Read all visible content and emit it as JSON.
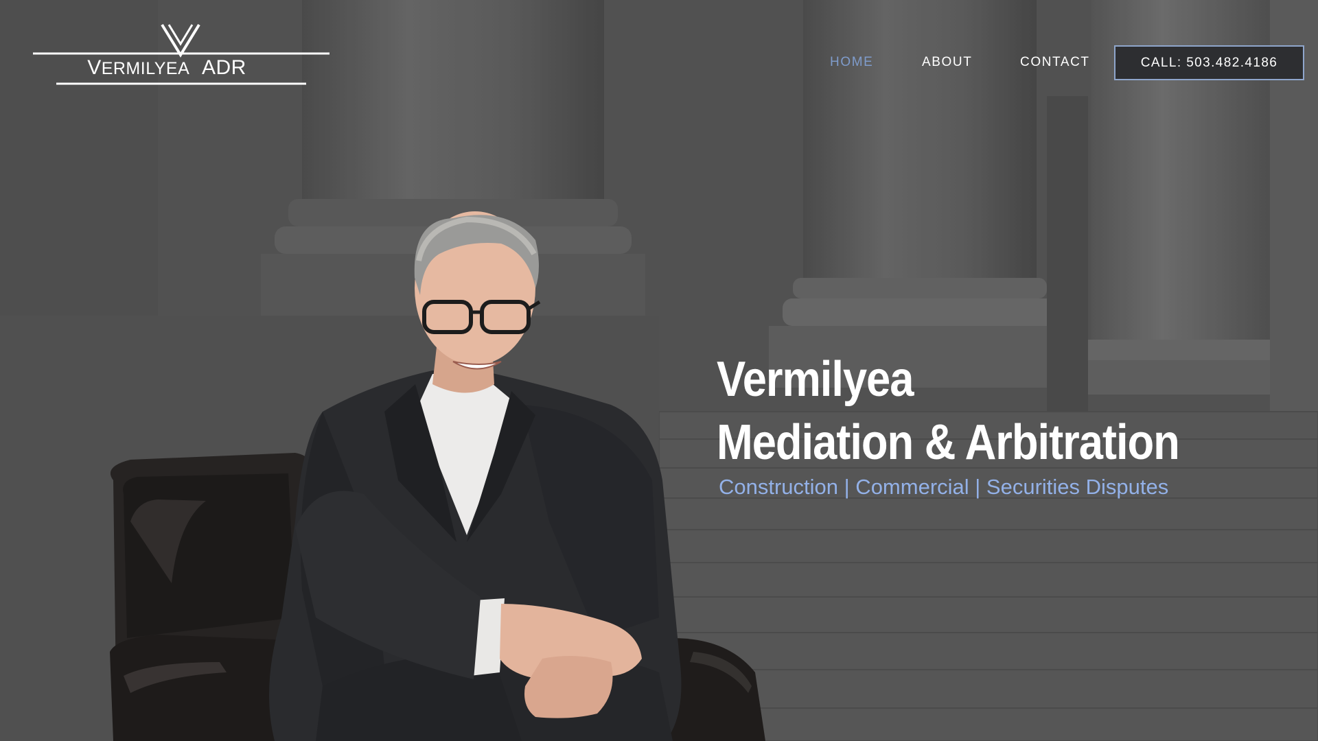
{
  "brand": {
    "name_first_letter": "V",
    "name_rest": "ERMILYEA",
    "name_suffix": "ADR"
  },
  "nav": {
    "items": [
      {
        "label": "HOME",
        "active": true
      },
      {
        "label": "ABOUT",
        "active": false
      },
      {
        "label": "CONTACT",
        "active": false
      }
    ],
    "call_label": "CALL: 503.482.4186"
  },
  "hero": {
    "title_line1": "Vermilyea",
    "title_line2": "Mediation & Arbitration",
    "subtitle": "Construction | Commercial | Securities Disputes"
  },
  "colors": {
    "accent": "#7f9ccc",
    "subtitle": "#93b1e8",
    "background": "#565656",
    "button_border": "#8fa6cc"
  },
  "icons": {
    "logo_mark": "v-chevron-icon"
  }
}
